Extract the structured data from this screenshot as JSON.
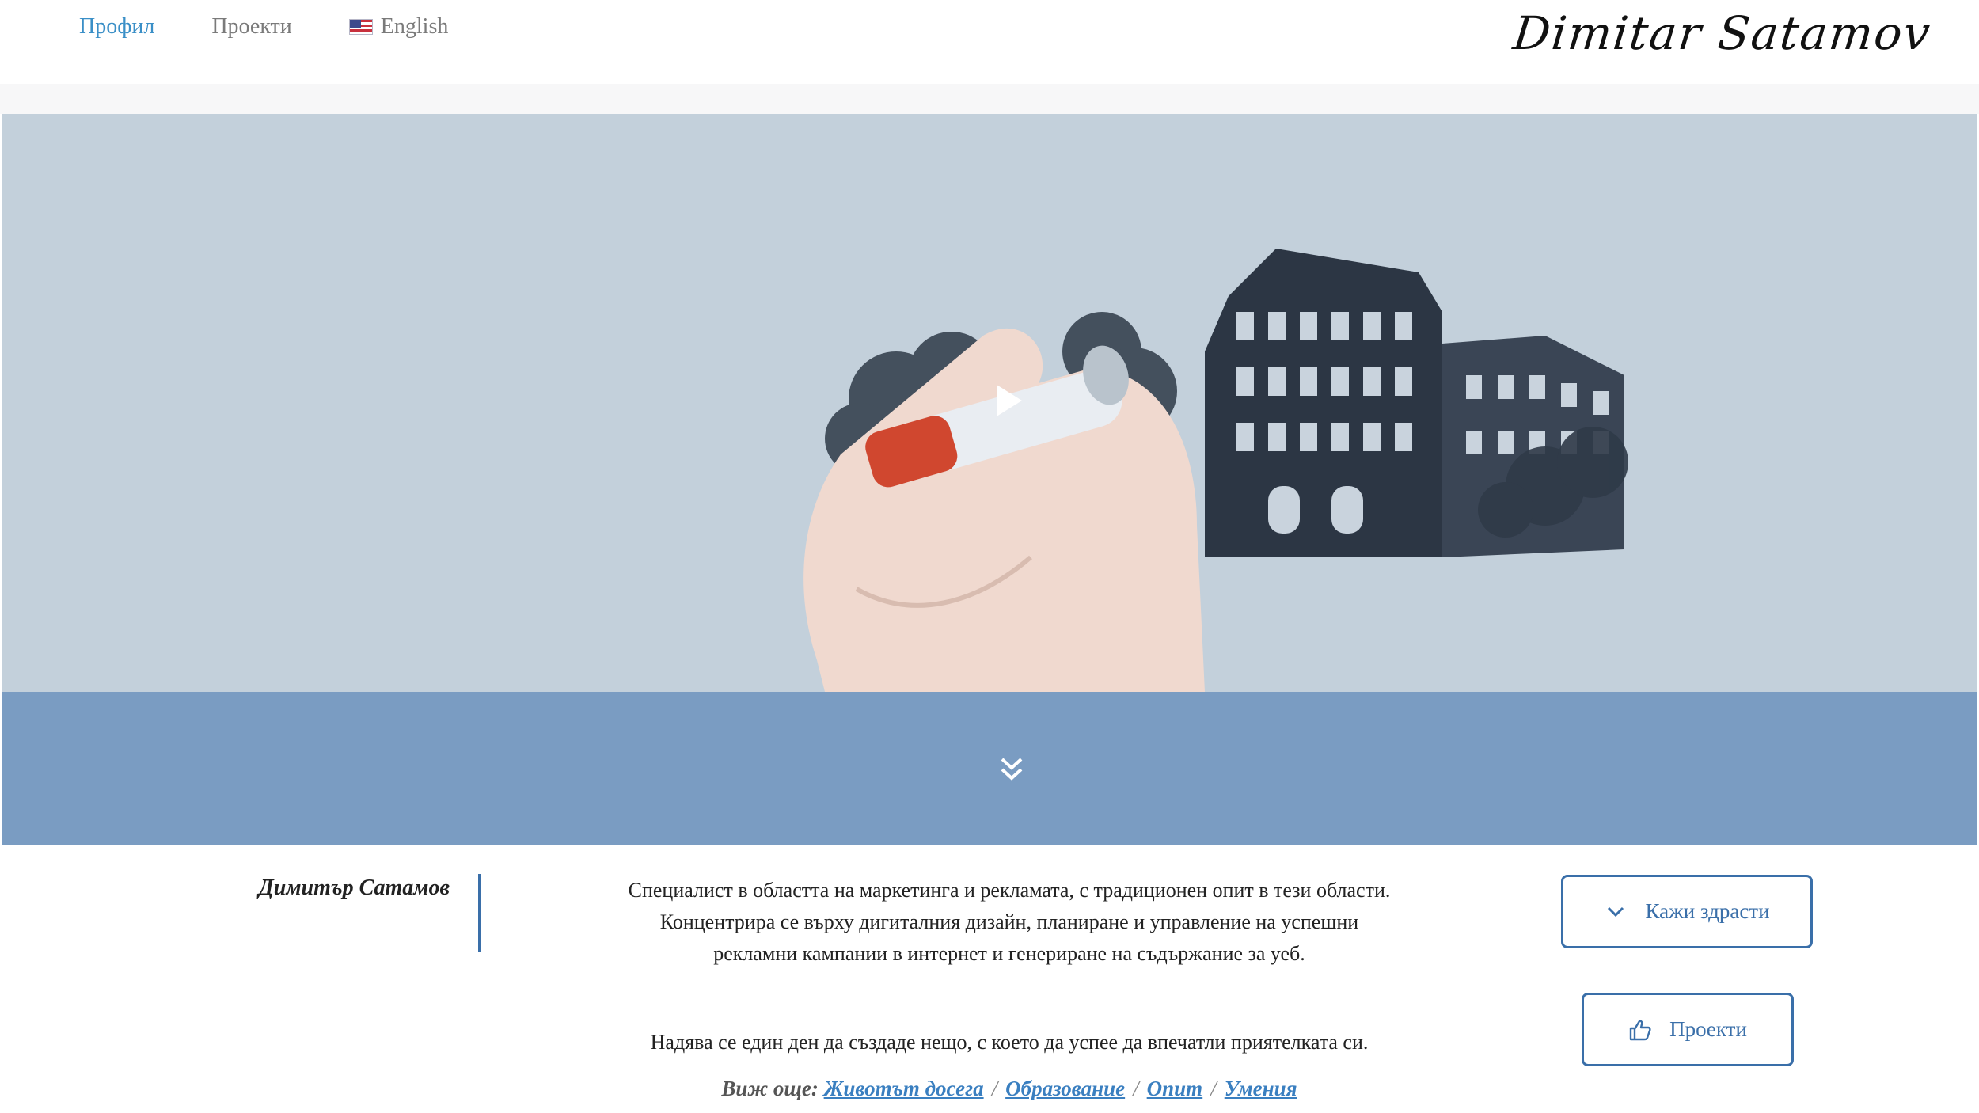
{
  "nav": {
    "items": [
      {
        "label": "Профил",
        "active": true
      },
      {
        "label": "Проекти",
        "active": false
      },
      {
        "label": "English",
        "active": false,
        "icon": "us-flag-icon"
      }
    ],
    "signature": "Dimitar Satamov"
  },
  "hero": {
    "play_icon": "play-icon",
    "scroll_icon": "double-chevron-down-icon"
  },
  "profile": {
    "name": "Димитър Сатамов",
    "bio_lines": [
      "Специалист в областта на маркетинга и рекламата, с  традиционен опит в тези области.",
      "Концентрира се върху дигиталния дизайн, планиране и управление на успешни",
      "рекламни кампании в интернет  и генериране на съдържание за уеб."
    ],
    "quote": "Надява се един ден да създаде нещо, с което да успее да впечатли приятелката си.",
    "see_more_label": "Виж още:",
    "links": [
      "Животът досега",
      "Образование",
      "Опит",
      "Умения"
    ]
  },
  "buttons": {
    "hello": {
      "label": "Кажи здрасти",
      "icon": "chevron-down-icon"
    },
    "projects": {
      "label": "Проекти",
      "icon": "thumbs-up-icon"
    }
  },
  "colors": {
    "accent": "#3a6fa9",
    "nav_active": "#3a8fc7",
    "hero_bg": "#c3d0db",
    "band_bg": "#7a9cc2"
  }
}
